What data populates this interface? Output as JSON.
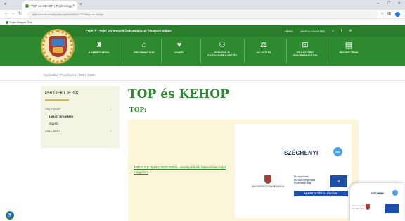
{
  "browser": {
    "tab_title": "TOP és KEHOP | Fejér megy...",
    "tab_close": "×",
    "new_tab": "+",
    "url": "fejer.hu/onkormanyzat/projektek/2014-2020/top-es-kehop",
    "bookmark": "Fejér Megyei Önk.",
    "window_controls": [
      "‒",
      "□",
      "×"
    ]
  },
  "site": {
    "title": "Fejér ® - Fejér Vármegyei Önkormányzat hivatalos oldala",
    "header_links": [
      "HÍREK",
      "AKADÁLYMENTES"
    ],
    "nav": [
      {
        "label": "A VÁRMEGYÉRŐL",
        "icon": "castle-icon"
      },
      {
        "label": "ÖNKORMÁNYZAT",
        "icon": "building-icon"
      },
      {
        "label": "VIVIDÉL",
        "icon": "heart-icon"
      },
      {
        "label": "REGIONÁLIS\nGAZDASÁGFEJLESZTÉS",
        "icon": "people-icon"
      },
      {
        "label": "VÁLASZTÁS",
        "icon": "ballot-icon"
      },
      {
        "label": "FEJLESZTÉSI\nÖNKORMÁNYZATOK",
        "icon": "chart-icon"
      },
      {
        "label": "PROJEKTJEINK",
        "icon": "document-icon"
      }
    ]
  },
  "breadcrumb": "Nyitóoldal / Projektjeink / 2014-2020",
  "sidebar": {
    "title": "PROJEKTJEINK",
    "items": [
      {
        "label": "2014-2020",
        "arrow": "⌄"
      },
      {
        "label": "Lezárt projektek",
        "sub": true,
        "bold": true
      },
      {
        "label": "Egyéb",
        "sub": true,
        "bold": false
      },
      {
        "label": "2021-2027",
        "arrow": "⌄"
      }
    ]
  },
  "page": {
    "title": "TOP és KEHOP",
    "subtitle": "TOP:",
    "project_link": "TOP-1.2.1-15-FE1-2020-00001 - Kerékpárbarát fejlesztések Fejér megyében"
  },
  "banner": {
    "szechenyi": "SZÉCHENYI",
    "year": "2020",
    "magyarorszag": "MAGYARORSZÁG KORMÁNYA",
    "eu_text": "Európai Unió\nEurópai Regionális\nFejlesztési Alap",
    "slogan": "BEFEKTETÉS A JÖVŐBE"
  },
  "float_badge": {
    "title": "SZÉCHENYI",
    "gray": "Széchenyi 2020\nEurópai Unió"
  },
  "accessibility_icon": "♿",
  "colors": {
    "brand_green": "#2e8a2e",
    "accent_yellow": "#e8b92a",
    "eu_blue": "#1e4fa8",
    "content_bg": "#fbf6d8"
  }
}
